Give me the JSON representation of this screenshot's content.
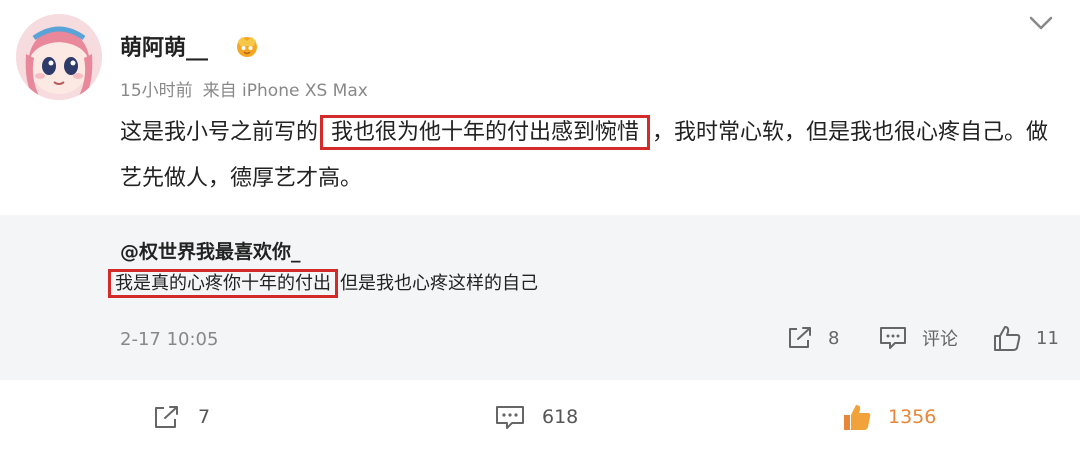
{
  "post": {
    "username": "萌阿萌__",
    "time": "15小时前",
    "source": "来自 iPhone XS Max",
    "text_before": "这是我小号之前写的",
    "text_highlight": "我也很为他十年的付出感到惋惜",
    "text_after": "，我时常心软，但是我也很心疼自己。做艺先做人，德厚艺才高。",
    "icons": {
      "avatar": "avatar-image",
      "vip": "vip-badge-icon",
      "more": "chevron-down-icon"
    }
  },
  "repost": {
    "username": "@权世界我最喜欢你_",
    "text_highlight": "我是真的心疼你十年的付出",
    "text_after": "但是我也心疼这样的自己",
    "time": "2-17 10:05",
    "actions": {
      "share_count": "8",
      "comment_label": "评论",
      "like_count": "11"
    }
  },
  "bottom_bar": {
    "share_count": "7",
    "comment_count": "618",
    "like_count": "1356"
  },
  "colors": {
    "highlight_border": "#d32a2a",
    "like_active": "#e8863a",
    "repost_bg": "#f4f5f7",
    "meta_text": "#888888"
  }
}
